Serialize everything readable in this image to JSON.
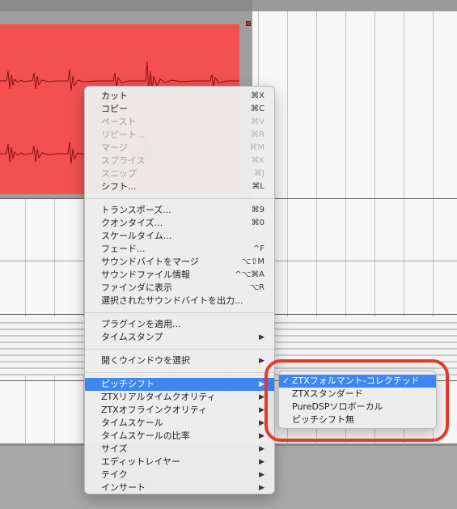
{
  "colors": {
    "region": "#f35050",
    "highlight": "#3d86f4",
    "annotation": "#e53a24"
  },
  "context_menu": {
    "groups": [
      [
        {
          "label": "カット",
          "shortcut": "⌘X",
          "enabled": true
        },
        {
          "label": "コピー",
          "shortcut": "⌘C",
          "enabled": true
        },
        {
          "label": "ペースト",
          "shortcut": "⌘V",
          "enabled": false
        },
        {
          "label": "リピート...",
          "shortcut": "⌘R",
          "enabled": false
        },
        {
          "label": "マージ",
          "shortcut": "⌘M",
          "enabled": false
        },
        {
          "label": "スプライス",
          "shortcut": "⌘K",
          "enabled": false
        },
        {
          "label": "スニップ",
          "shortcut": "⌘J",
          "enabled": false
        },
        {
          "label": "シフト...",
          "shortcut": "⌘L",
          "enabled": true
        }
      ],
      [
        {
          "label": "トランスポーズ...",
          "shortcut": "⌘9",
          "enabled": true
        },
        {
          "label": "クオンタイズ...",
          "shortcut": "⌘0",
          "enabled": true
        },
        {
          "label": "スケールタイム...",
          "shortcut": "",
          "enabled": true
        },
        {
          "label": "フェード...",
          "shortcut": "^F",
          "enabled": true
        },
        {
          "label": "サウンドバイトをマージ",
          "shortcut": "⌥⇧M",
          "enabled": true
        },
        {
          "label": "サウンドファイル情報",
          "shortcut": "^⌥⌘A",
          "enabled": true
        },
        {
          "label": "ファインダに表示",
          "shortcut": "⌥R",
          "enabled": true
        },
        {
          "label": "選択されたサウンドバイトを出力...",
          "shortcut": "",
          "enabled": true
        }
      ],
      [
        {
          "label": "プラグインを適用...",
          "enabled": true
        },
        {
          "label": "タイムスタンプ",
          "submenu": true,
          "enabled": true
        }
      ],
      [
        {
          "label": "開くウインドウを選択",
          "submenu": true,
          "enabled": true
        }
      ],
      [
        {
          "label": "ピッチシフト",
          "submenu": true,
          "enabled": true,
          "highlighted": true
        },
        {
          "label": "ZTXリアルタイムクオリティ",
          "submenu": true,
          "enabled": true
        },
        {
          "label": "ZTXオフラインクオリティ",
          "submenu": true,
          "enabled": true
        },
        {
          "label": "タイムスケール",
          "submenu": true,
          "enabled": true
        },
        {
          "label": "タイムスケールの比率",
          "submenu": true,
          "enabled": true
        },
        {
          "label": "サイズ",
          "submenu": true,
          "enabled": true
        },
        {
          "label": "エディットレイヤー",
          "submenu": true,
          "enabled": true
        },
        {
          "label": "テイク",
          "submenu": true,
          "enabled": true
        },
        {
          "label": "インサート",
          "submenu": true,
          "enabled": true
        }
      ]
    ],
    "submenu_arrow": "▶"
  },
  "pitch_submenu": {
    "check_mark": "✓",
    "items": [
      {
        "label": "ZTXフォルマント-コレクテッド",
        "checked": true,
        "highlighted": true
      },
      {
        "label": "ZTXスタンダード",
        "checked": false
      },
      {
        "label": "PureDSPソロボーカル",
        "checked": false
      },
      {
        "label": "ピッチシフト無",
        "checked": false
      }
    ]
  }
}
